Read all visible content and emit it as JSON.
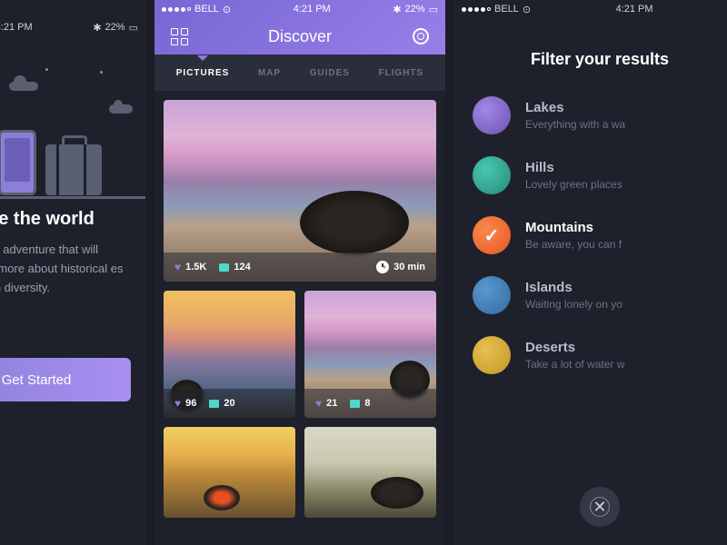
{
  "status": {
    "carrier": "BELL",
    "time": "4:21 PM",
    "battery": "22%"
  },
  "onboard": {
    "title": "Explore the world",
    "description": "e changing adventure that will nderstand more about historical es and human diversity.",
    "cta": "Get Started",
    "pager_active": 2
  },
  "discover": {
    "title": "Discover",
    "tabs": [
      "PICTURES",
      "MAP",
      "GUIDES",
      "FLIGHTS"
    ],
    "active_tab": 0,
    "cards": {
      "big": {
        "likes": "1.5K",
        "comments": "124",
        "time": "30 min"
      },
      "row1": [
        {
          "likes": "96",
          "comments": "20"
        },
        {
          "likes": "21",
          "comments": "8"
        }
      ]
    }
  },
  "filter": {
    "title": "Filter your results",
    "items": [
      {
        "name": "Lakes",
        "desc": "Everything with a wa",
        "color": "fc1"
      },
      {
        "name": "Hills",
        "desc": "Lovely green places",
        "color": "fc2"
      },
      {
        "name": "Mountains",
        "desc": "Be aware, you can f",
        "color": "fc3",
        "active": true
      },
      {
        "name": "Islands",
        "desc": "Waiting lonely on yo",
        "color": "fc4"
      },
      {
        "name": "Deserts",
        "desc": "Take a lot of water w",
        "color": "fc5"
      }
    ]
  }
}
